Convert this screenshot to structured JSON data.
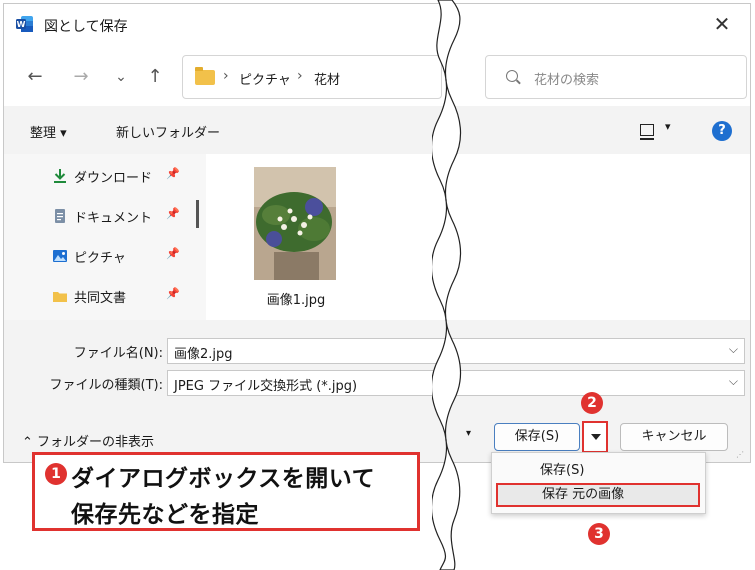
{
  "window": {
    "title": "図として保存",
    "close_glyph": "✕"
  },
  "nav": {
    "back_glyph": "←",
    "forward_glyph": "→",
    "recent_glyph": "⌄",
    "up_glyph": "↑",
    "breadcrumb": [
      "ピクチャ",
      "花材"
    ],
    "crumb_sep": "›",
    "search_placeholder": "花材の検索"
  },
  "commandbar": {
    "organize_label": "整理 ▾",
    "new_folder_label": "新しいフォルダー",
    "view_caret": "▾",
    "help_glyph": "?"
  },
  "sidebar": {
    "items": [
      {
        "label": "ダウンロード",
        "icon": "download-icon",
        "pin": "📌"
      },
      {
        "label": "ドキュメント",
        "icon": "document-icon",
        "pin": "📌"
      },
      {
        "label": "ピクチャ",
        "icon": "pictures-icon",
        "pin": "📌"
      },
      {
        "label": "共同文書",
        "icon": "folder-icon",
        "pin": "📌"
      }
    ]
  },
  "files": [
    {
      "name": "画像1.jpg",
      "icon": "image-thumbnail"
    }
  ],
  "form": {
    "filename_label": "ファイル名(N):",
    "filename_value": "画像2.jpg",
    "filetype_label": "ファイルの種類(T):",
    "filetype_value": "JPEG ファイル交換形式 (*.jpg)",
    "dropdown_glyph": "⌵"
  },
  "footer": {
    "hide_folders_label": "フォルダーの非表示",
    "hide_folders_glyph": "⌃",
    "save_label": "保存(S)",
    "cancel_label": "キャンセル",
    "left_caret": "▾"
  },
  "save_menu": {
    "items": [
      "保存(S)",
      "保存 元の画像"
    ]
  },
  "annotations": {
    "badge1": "1",
    "badge2": "2",
    "badge3": "3",
    "callout_line1": "ダイアログボックスを開いて",
    "callout_line2": "保存先などを指定",
    "accent_color": "#e0322f"
  }
}
